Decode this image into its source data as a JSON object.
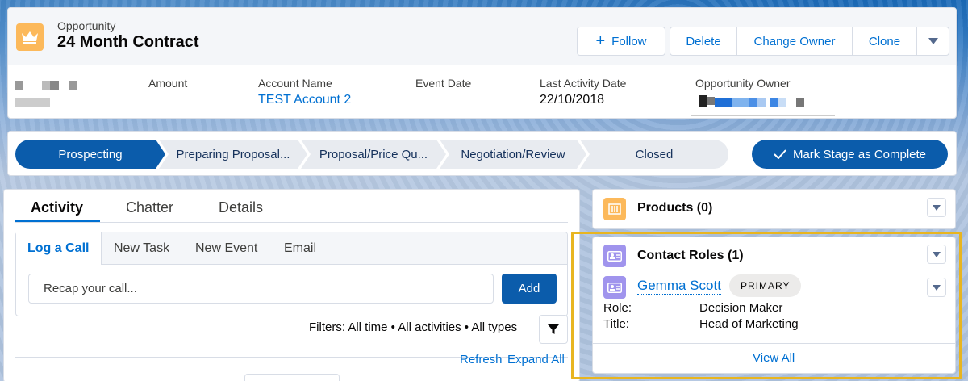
{
  "colors": {
    "brand": "#0b5cab",
    "link": "#0070d2",
    "crown": "#fcb95b",
    "contact_icon": "#a094ed",
    "product_icon": "#fcb95b",
    "highlight": "#e8b520"
  },
  "header": {
    "object_type": "Opportunity",
    "record_name": "24 Month Contract",
    "icon": "crown-icon",
    "buttons": {
      "follow": "Follow",
      "delete": "Delete",
      "change_owner": "Change Owner",
      "clone": "Clone"
    },
    "fields": [
      {
        "label": "Amount",
        "value": ""
      },
      {
        "label": "Account Name",
        "value": "TEST Account 2"
      },
      {
        "label": "Event Date",
        "value": ""
      },
      {
        "label": "Last Activity Date",
        "value": "22/10/2018"
      },
      {
        "label": "Opportunity Owner",
        "value": ""
      }
    ]
  },
  "path": {
    "steps": [
      "Prospecting",
      "Preparing Proposal...",
      "Proposal/Price Qu...",
      "Negotiation/Review",
      "Closed"
    ],
    "active_step": "Prospecting",
    "mark_complete": "Mark Stage as Complete"
  },
  "activity": {
    "tabs": [
      "Activity",
      "Chatter",
      "Details"
    ],
    "active_tab": "Activity",
    "publisher_tabs": [
      "Log a Call",
      "New Task",
      "New Event",
      "Email"
    ],
    "recap_placeholder": "Recap your call...",
    "add_label": "Add",
    "filters_text": "Filters: All time • All activities • All types",
    "refresh": "Refresh",
    "expand_all": "Expand All"
  },
  "products": {
    "title": "Products (0)"
  },
  "contact_roles": {
    "title": "Contact Roles (1)",
    "contact_name": "Gemma Scott",
    "badge": "PRIMARY",
    "role_label": "Role:",
    "role_value": "Decision Maker",
    "title_label": "Title:",
    "title_value": "Head of Marketing",
    "view_all": "View All"
  }
}
